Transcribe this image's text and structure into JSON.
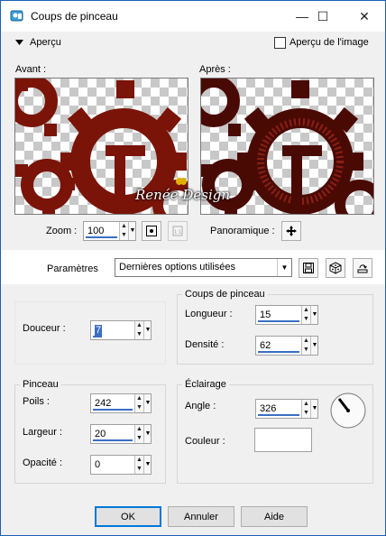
{
  "window": {
    "title": "Coups de pinceau",
    "minimize_icon": "minimize-icon",
    "maximize_icon": "maximize-icon",
    "close_icon": "close-icon",
    "minimize_glyph": "—",
    "maximize_glyph": "☐",
    "close_glyph": "✕"
  },
  "preview": {
    "section_label": "Aperçu",
    "apercu_image_label": "Aperçu de l'image",
    "apercu_image_checked": false,
    "before_label": "Avant :",
    "after_label": "Après :",
    "watermark_text": "Renée Design",
    "zoom_label": "Zoom :",
    "zoom_value": "100",
    "pan_label": "Panoramique :"
  },
  "settings": {
    "label": "Paramètres",
    "selected": "Dernières options utilisées"
  },
  "fields": {
    "douceur_label": "Douceur :",
    "douceur_value": "7",
    "coups_group": "Coups de pinceau",
    "longueur_label": "Longueur :",
    "longueur_value": "15",
    "densite_label": "Densité :",
    "densite_value": "62",
    "pinceau_group": "Pinceau",
    "poils_label": "Poils :",
    "poils_value": "242",
    "largeur_label": "Largeur :",
    "largeur_value": "20",
    "opacite_label": "Opacité :",
    "opacite_value": "0",
    "eclairage_group": "Éclairage",
    "angle_label": "Angle :",
    "angle_value": "326",
    "couleur_label": "Couleur :",
    "couleur_value": "#ffffff"
  },
  "buttons": {
    "ok": "OK",
    "cancel": "Annuler",
    "help": "Aide"
  },
  "colors": {
    "accent": "#0078d7",
    "gear": "#7a1408",
    "gear_dark": "#4a0a04"
  }
}
